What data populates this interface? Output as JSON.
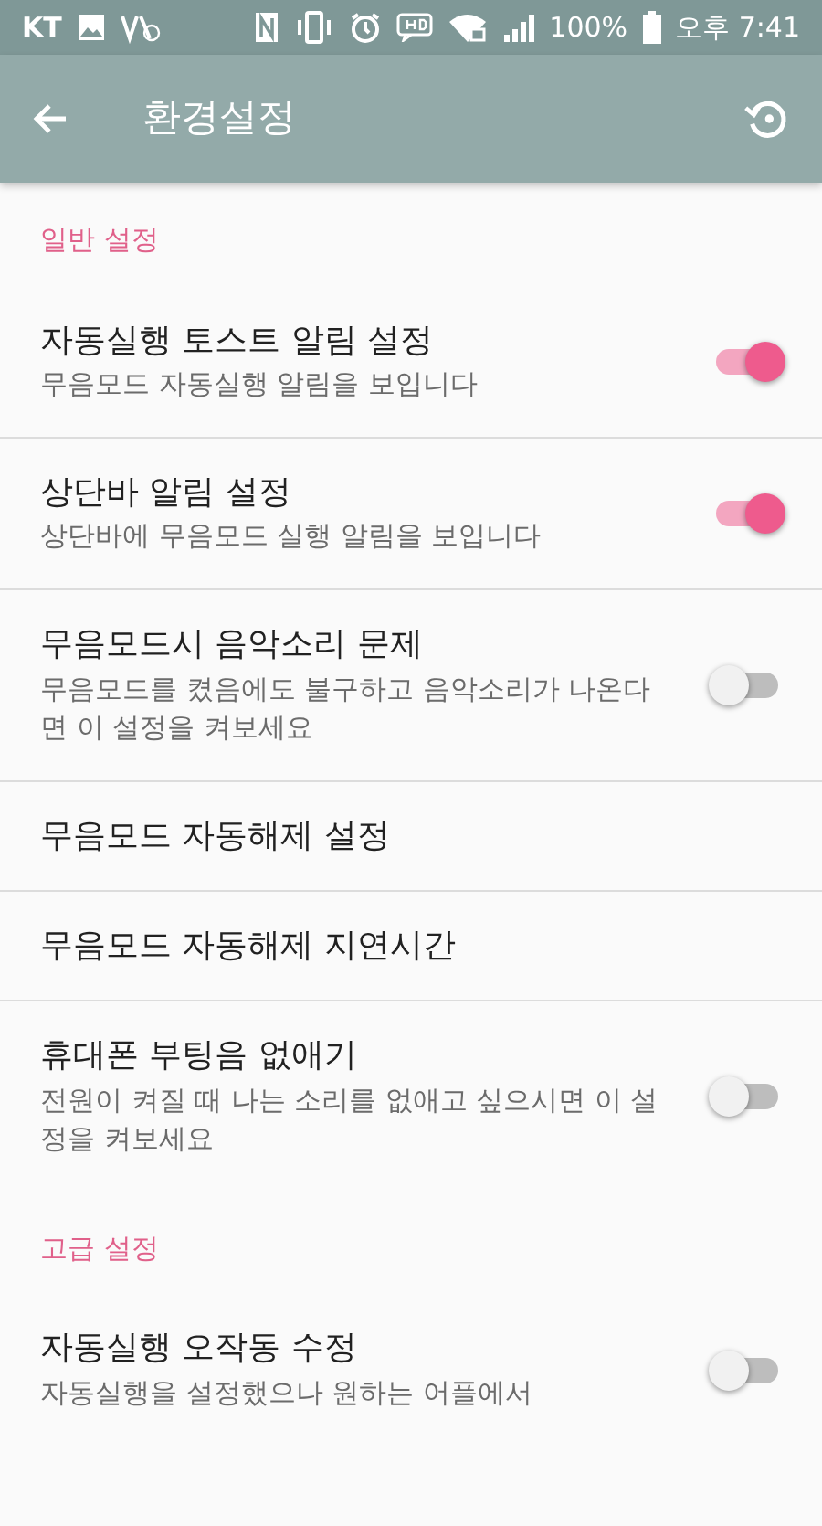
{
  "status_bar": {
    "carrier": "KT",
    "battery": "100%",
    "time": "오후 7:41"
  },
  "toolbar": {
    "title": "환경설정"
  },
  "sections": [
    {
      "title": "일반 설정",
      "items": [
        {
          "title": "자동실행 토스트 알림 설정",
          "summary": "무음모드 자동실행 알림을 보입니다",
          "on": true
        },
        {
          "title": "상단바 알림 설정",
          "summary": "상단바에 무음모드 실행 알림을 보입니다",
          "on": true
        },
        {
          "title": "무음모드시 음악소리 문제",
          "summary": "무음모드를 켰음에도 불구하고 음악소리가 나온다면 이 설정을 켜보세요",
          "on": false
        },
        {
          "title": "무음모드 자동해제 설정"
        },
        {
          "title": "무음모드 자동해제 지연시간"
        },
        {
          "title": "휴대폰 부팅음 없애기",
          "summary": "전원이 켜질 때 나는 소리를 없애고 싶으시면 이 설정을 켜보세요",
          "on": false
        }
      ]
    },
    {
      "title": "고급 설정",
      "items": [
        {
          "title": "자동실행 오작동 수정",
          "summary": "자동실행을 설정했으나 원하는 어플에서",
          "on": false
        }
      ]
    }
  ]
}
